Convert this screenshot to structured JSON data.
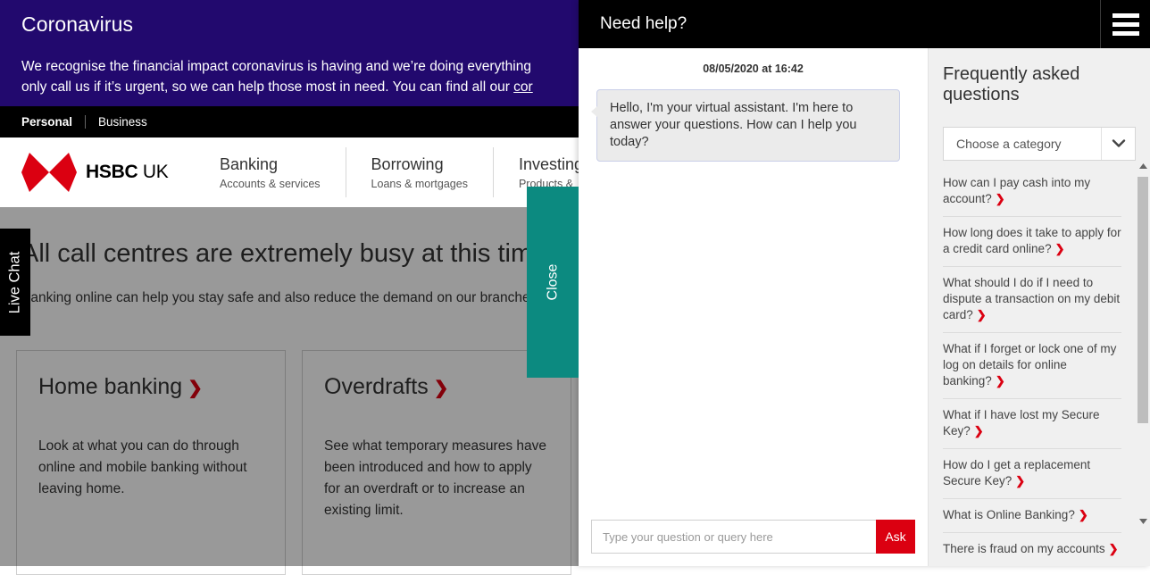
{
  "colors": {
    "covid_banner_bg": "#22096e",
    "brand_red": "#db0011",
    "close_tab_teal": "#0c8a80",
    "chat_header_bg": "#000000",
    "faq_panel_bg": "#f0f0f0",
    "bubble_bg": "#ebebeb"
  },
  "covid": {
    "title": "Coronavirus",
    "body_line1": "We recognise the financial impact coronavirus is having and we’re doing everything",
    "body_line2_pre": "only call us if it’s urgent, so we can help those most in need. You can find all our ",
    "body_line2_link": "cor"
  },
  "segments": {
    "personal": "Personal",
    "business": "Business"
  },
  "brand": {
    "logo_bold": "HSBC",
    "logo_light": "UK",
    "logo_icon": "hsbc-hexagon-logo"
  },
  "nav": {
    "items": [
      {
        "title": "Banking",
        "sub": "Accounts & services"
      },
      {
        "title": "Borrowing",
        "sub": "Loans & mortgages"
      },
      {
        "title": "Investing",
        "sub": "Products &"
      }
    ]
  },
  "notice": {
    "heading": "All call centres are extremely busy at this time",
    "body": "Banking online can help you stay safe and also reduce the demand on our branches and call centres. Here are some things you can do from home."
  },
  "cards": [
    {
      "title": "Home banking",
      "chevron": "❯",
      "body": "Look at what you can do through online and mobile banking without leaving home."
    },
    {
      "title": "Overdrafts",
      "chevron": "❯",
      "body": "See what temporary measures have been introduced and how to apply for an overdraft or to increase an existing limit."
    }
  ],
  "live_chat_tab": {
    "label": "Live Chat"
  },
  "close_tab": {
    "label": "Close"
  },
  "chat": {
    "header_title": "Need help?",
    "menu_icon": "hamburger-menu-icon",
    "timestamp": "08/05/2020 at 16:42",
    "messages": [
      {
        "sender": "virtual-assistant",
        "text": "Hello, I'm your virtual assistant. I'm here to answer your questions. How can I help you today?"
      }
    ],
    "composer": {
      "value": "",
      "placeholder": "Type your question or query here",
      "ask_label": "Ask"
    }
  },
  "faq": {
    "heading": "Frequently asked questions",
    "category_select": {
      "selected": "Choose a category",
      "arrow_icon": "chevron-down-icon"
    },
    "chevron": "❯",
    "items": [
      "How can I pay cash into my account?",
      "How long does it take to apply for a credit card online?",
      "What should I do if I need to dispute a transaction on my debit card?",
      "What if I forget or lock one of my log on details for online banking?",
      "What if I have lost my Secure Key?",
      "How do I get a replacement Secure Key?",
      "What is Online Banking?",
      "There is fraud on my accounts"
    ],
    "scrollbar": {
      "up_icon": "scroll-up-arrow-icon",
      "down_icon": "scroll-down-arrow-icon"
    }
  }
}
